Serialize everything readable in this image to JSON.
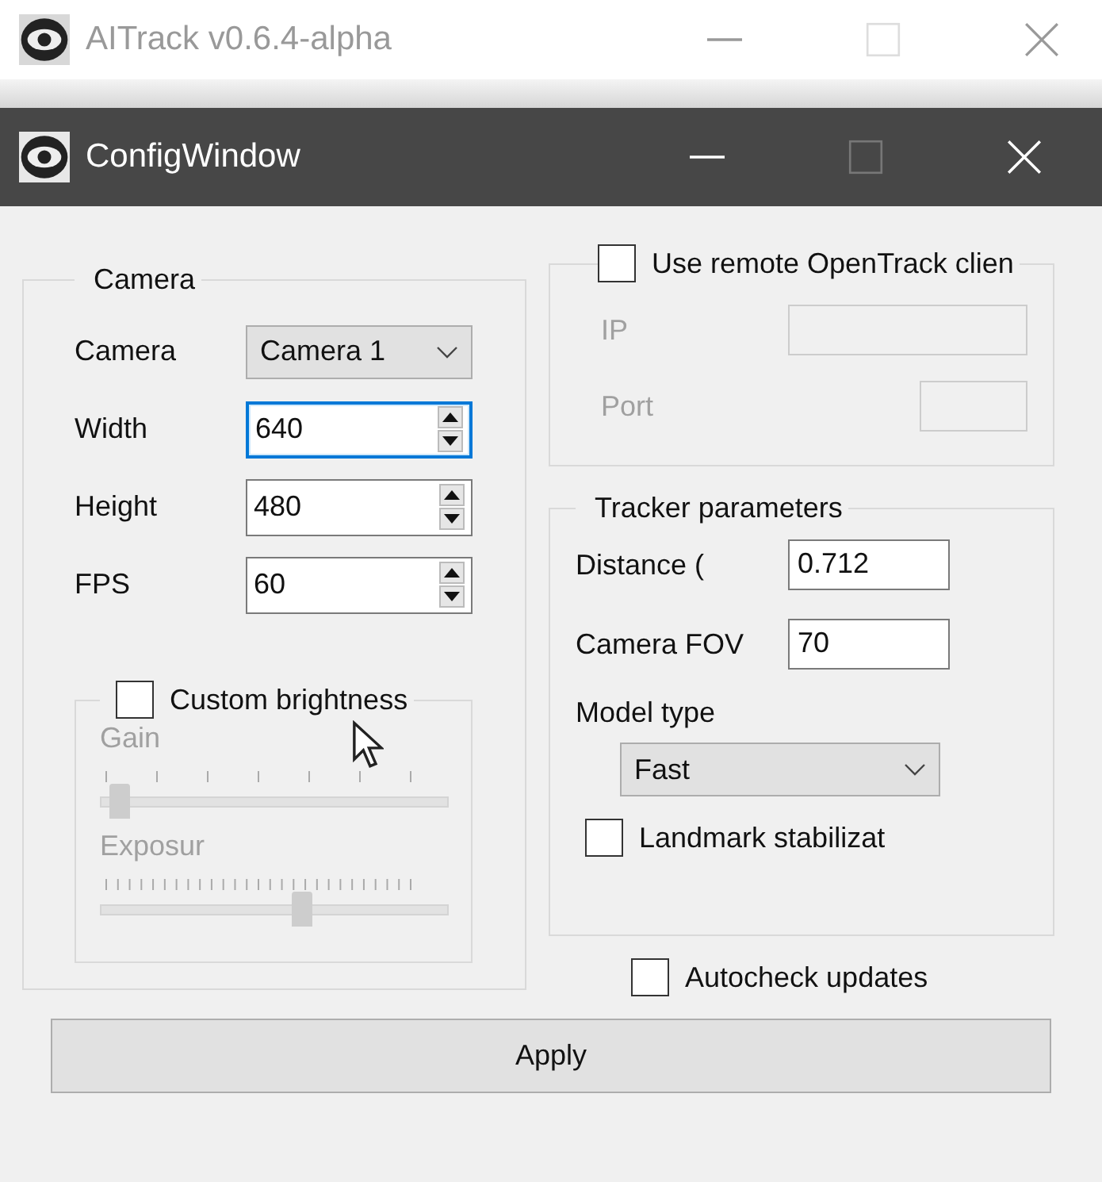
{
  "background_window": {
    "title": "AITrack v0.6.4-alpha"
  },
  "window": {
    "title": "ConfigWindow"
  },
  "camera_group": {
    "title": "Camera",
    "fields": [
      {
        "kind": "dropdown",
        "label": "Camera",
        "value": "Camera 1"
      },
      {
        "kind": "spinbox",
        "label": "Width",
        "value": "640",
        "focused": true
      },
      {
        "kind": "spinbox",
        "label": "Height",
        "value": "480",
        "focused": false
      },
      {
        "kind": "spinbox",
        "label": "FPS",
        "value": "60",
        "focused": false
      }
    ],
    "brightness": {
      "label": "Custom brightness",
      "checked": false,
      "sliders": [
        {
          "label": "Gain",
          "kind": "coarse",
          "level": 0.03
        },
        {
          "label": "Exposur",
          "kind": "fine",
          "level": 0.56
        }
      ]
    }
  },
  "remote": {
    "label": "Use remote OpenTrack clien",
    "checked": false,
    "fields": [
      {
        "label": "IP",
        "kind": "wide"
      },
      {
        "label": "Port",
        "kind": "narrow"
      }
    ]
  },
  "tracker": {
    "title": "Tracker parameters",
    "fields": [
      {
        "label": "Distance (",
        "value": "0.712"
      },
      {
        "label": "Camera FOV",
        "value": "70"
      }
    ],
    "model_type": {
      "label": "Model type",
      "value": "Fast"
    },
    "stabilization": {
      "label": "Landmark stabilizat",
      "checked": false
    }
  },
  "autocheck": {
    "label": "Autocheck updates",
    "checked": false
  },
  "apply_button": "Apply"
}
